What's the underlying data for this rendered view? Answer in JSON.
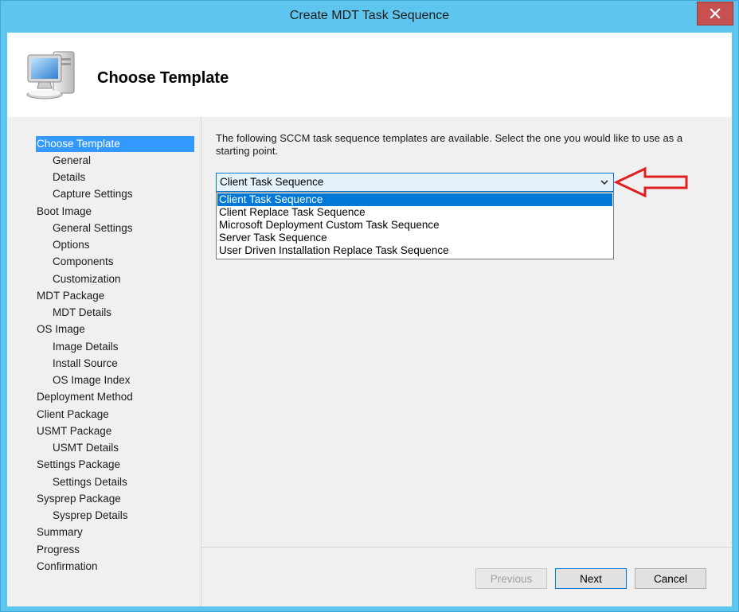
{
  "window": {
    "title": "Create MDT Task Sequence"
  },
  "header": {
    "title": "Choose Template",
    "icon": "computer-icon"
  },
  "nav": {
    "items": [
      {
        "label": "Choose Template",
        "level": 0,
        "selected": true
      },
      {
        "label": "General",
        "level": 1
      },
      {
        "label": "Details",
        "level": 1
      },
      {
        "label": "Capture Settings",
        "level": 1
      },
      {
        "label": "Boot Image",
        "level": 0
      },
      {
        "label": "General Settings",
        "level": 1
      },
      {
        "label": "Options",
        "level": 1
      },
      {
        "label": "Components",
        "level": 1
      },
      {
        "label": "Customization",
        "level": 1
      },
      {
        "label": "MDT Package",
        "level": 0
      },
      {
        "label": "MDT Details",
        "level": 1
      },
      {
        "label": "OS Image",
        "level": 0
      },
      {
        "label": "Image Details",
        "level": 1
      },
      {
        "label": "Install Source",
        "level": 1
      },
      {
        "label": "OS Image Index",
        "level": 1
      },
      {
        "label": "Deployment Method",
        "level": 0
      },
      {
        "label": "Client Package",
        "level": 0
      },
      {
        "label": "USMT Package",
        "level": 0
      },
      {
        "label": "USMT Details",
        "level": 1
      },
      {
        "label": "Settings Package",
        "level": 0
      },
      {
        "label": "Settings Details",
        "level": 1
      },
      {
        "label": "Sysprep Package",
        "level": 0
      },
      {
        "label": "Sysprep Details",
        "level": 1
      },
      {
        "label": "Summary",
        "level": 0
      },
      {
        "label": "Progress",
        "level": 0
      },
      {
        "label": "Confirmation",
        "level": 0
      }
    ]
  },
  "main": {
    "prompt": "The following SCCM task sequence templates are available.  Select the one you would like to use as a starting point.",
    "template_select": {
      "value": "Client Task Sequence",
      "options": [
        "Client Task Sequence",
        "Client Replace Task Sequence",
        "Microsoft Deployment Custom Task Sequence",
        "Server Task Sequence",
        "User Driven Installation Replace Task Sequence"
      ],
      "highlighted_index": 0
    }
  },
  "buttons": {
    "previous": "Previous",
    "next": "Next",
    "cancel": "Cancel"
  },
  "colors": {
    "titlebar": "#5ec5ee",
    "close": "#c75050",
    "selection": "#3399ff",
    "annotation_arrow": "#e02020"
  }
}
